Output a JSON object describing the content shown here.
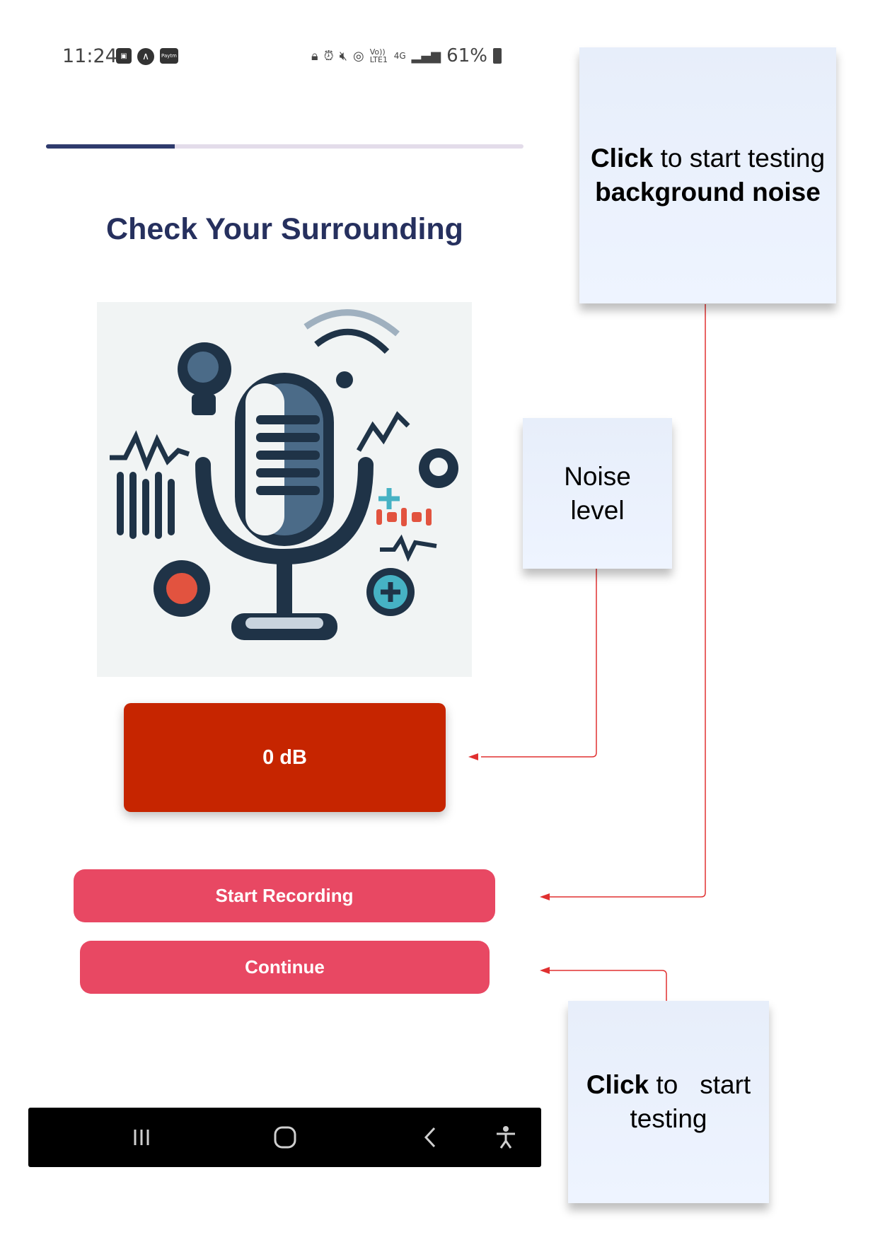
{
  "status_bar": {
    "time": "11:24",
    "left_icons": [
      "image-icon",
      "a-circle-icon",
      "paytm-icon"
    ],
    "paytm_label": "Paytm",
    "right_icons": [
      "lock-icon",
      "alarm-icon",
      "mute-icon",
      "hotspot-icon",
      "volte-icon",
      "4g-icon",
      "signal-icon"
    ],
    "volte_label": "Vo)) LTE1",
    "net_label": "4G",
    "battery": "61%"
  },
  "progress": {
    "value": 0.27,
    "fill_color": "#2f3b6d",
    "track_color": "#e3dcea"
  },
  "page": {
    "title": "Check Your Surrounding",
    "noise_value": "0 dB",
    "start_label": "Start Recording",
    "continue_label": "Continue"
  },
  "colors": {
    "title": "#26305e",
    "db_box": "#c62500",
    "button": "#e84863",
    "arrow": "#e03030"
  },
  "illustration_icon": "microphone-illustration",
  "nav_bar": {
    "icons": [
      "recents-icon",
      "home-icon",
      "back-icon",
      "accessibility-icon"
    ]
  },
  "annotations": [
    {
      "bold": "Click",
      "rest": " to start testing",
      "bold2": "background noise"
    },
    {
      "text": "Noise level"
    },
    {
      "bold": "Click",
      "rest": " to   start testing"
    }
  ]
}
